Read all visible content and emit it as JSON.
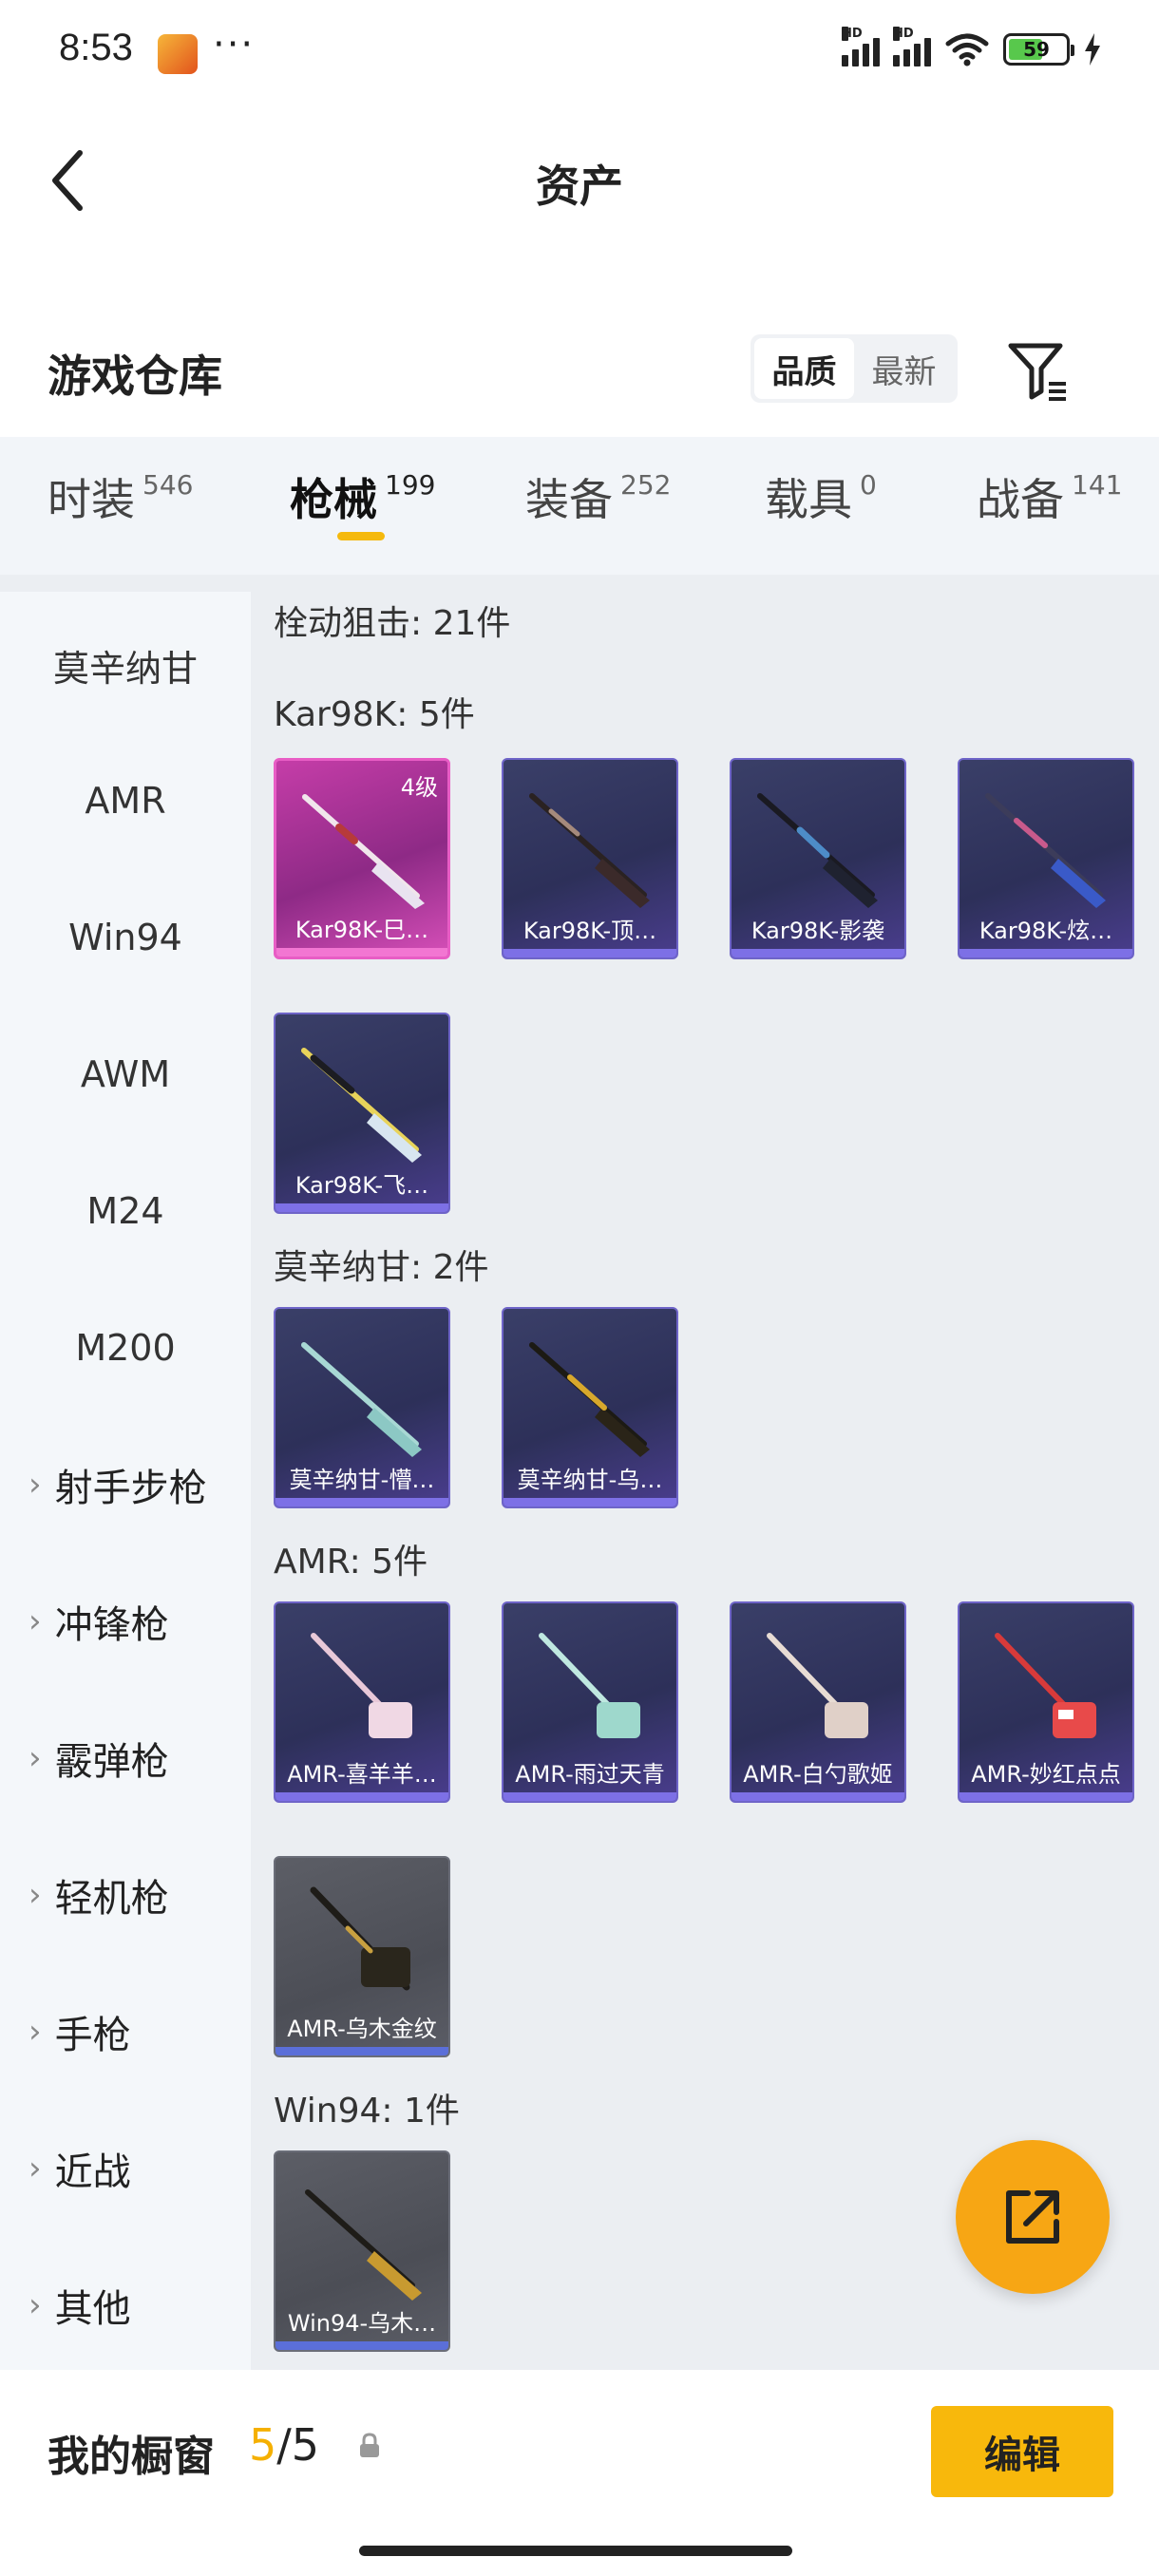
{
  "status": {
    "time": "8:53",
    "more": "···",
    "battery": "59",
    "hd1": "HD",
    "hd2": "HD"
  },
  "nav": {
    "title": "资产"
  },
  "warehouse": {
    "title": "游戏仓库",
    "sort_quality": "品质",
    "sort_newest": "最新"
  },
  "tabs": [
    {
      "label": "时装",
      "count": "546"
    },
    {
      "label": "枪械",
      "count": "199"
    },
    {
      "label": "装备",
      "count": "252"
    },
    {
      "label": "载具",
      "count": "0"
    },
    {
      "label": "战备",
      "count": "141"
    }
  ],
  "sidebar": {
    "items": [
      "莫辛纳甘",
      "AMR",
      "Win94",
      "AWM",
      "M24",
      "M200"
    ],
    "groups": [
      "射手步枪",
      "冲锋枪",
      "霰弹枪",
      "轻机枪",
      "手枪",
      "近战",
      "其他"
    ]
  },
  "content": {
    "category_summary": "栓动狙击: 21件",
    "sections": [
      {
        "title": "Kar98K: 5件",
        "items": [
          {
            "name": "Kar98K-巳…",
            "level": "4级"
          },
          {
            "name": "Kar98K-顶…"
          },
          {
            "name": "Kar98K-影袭"
          },
          {
            "name": "Kar98K-炫…"
          },
          {
            "name": "Kar98K-飞…"
          }
        ]
      },
      {
        "title": "莫辛纳甘: 2件",
        "items": [
          {
            "name": "莫辛纳甘-懵…"
          },
          {
            "name": "莫辛纳甘-乌…"
          }
        ]
      },
      {
        "title": "AMR: 5件",
        "items": [
          {
            "name": "AMR-喜羊羊…"
          },
          {
            "name": "AMR-雨过天青"
          },
          {
            "name": "AMR-白勺歌姬"
          },
          {
            "name": "AMR-妙红点点"
          },
          {
            "name": "AMR-乌木金纹"
          }
        ]
      },
      {
        "title": "Win94: 1件",
        "items": [
          {
            "name": "Win94-乌木…"
          }
        ]
      }
    ]
  },
  "showcase": {
    "label": "我的橱窗",
    "current": "5",
    "sep": "/",
    "total": "5",
    "edit": "编辑"
  },
  "colors": {
    "accent": "#f8b80c",
    "tab_underline": "#f5b90d",
    "fab": "#f7a614"
  }
}
